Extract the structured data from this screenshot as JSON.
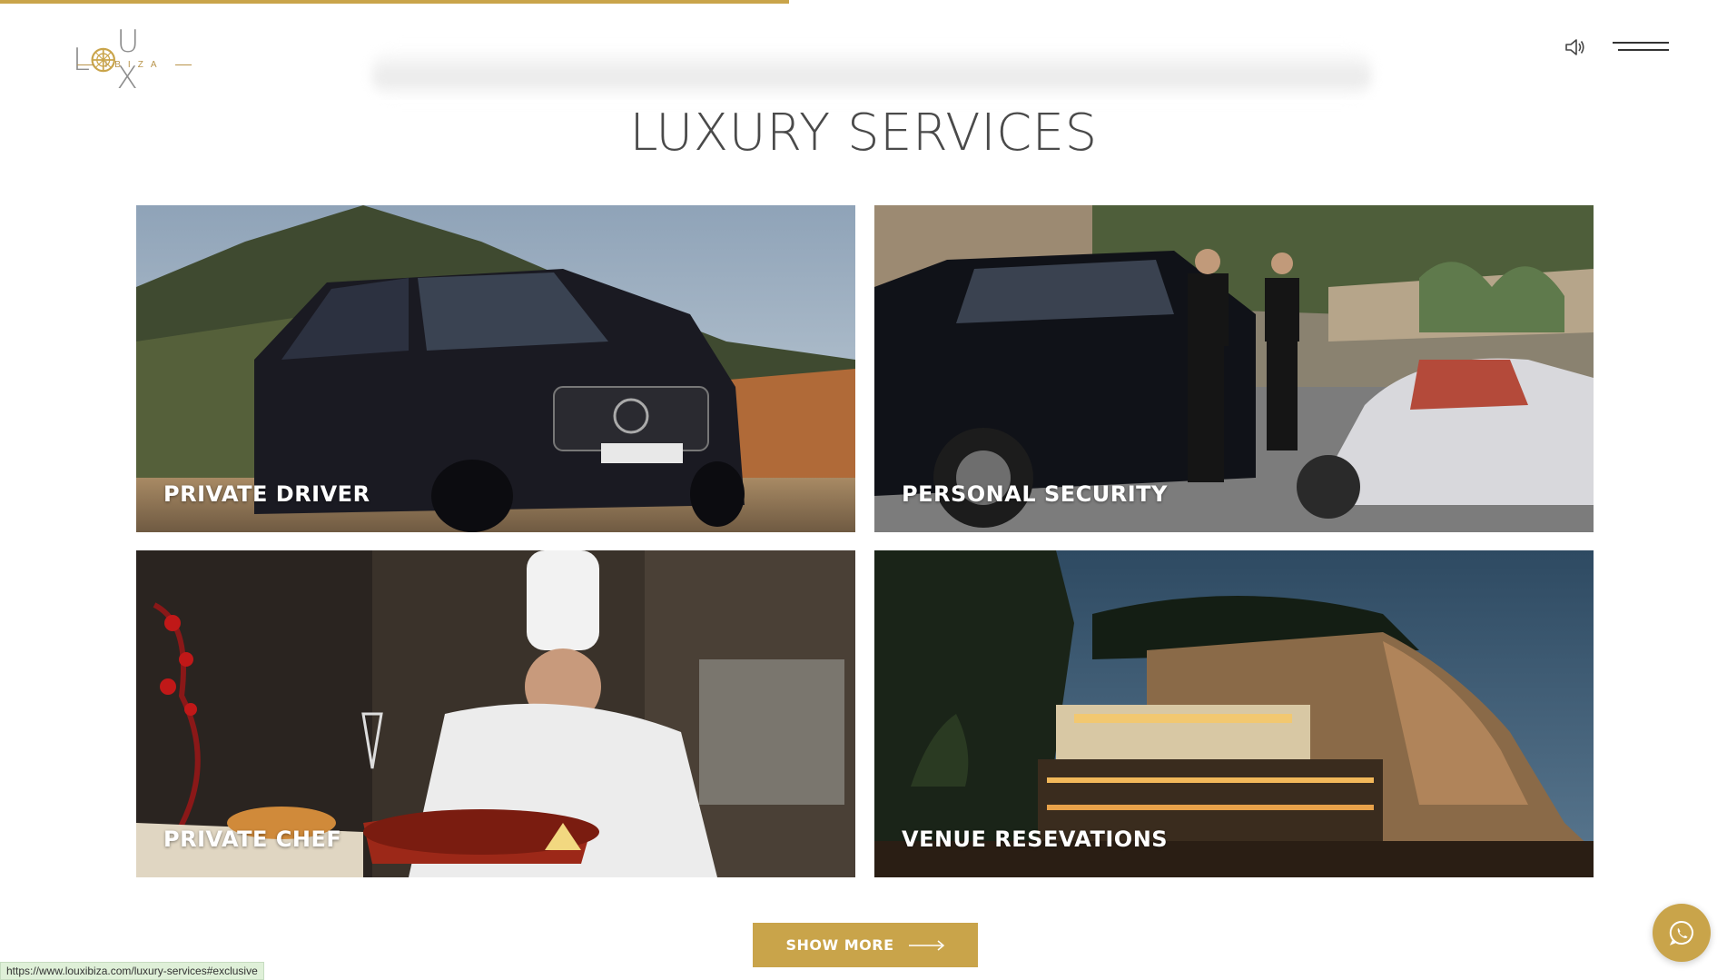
{
  "scroll_progress": 0.457,
  "colors": {
    "accent": "#c9a44a",
    "title": "#4a4a4a",
    "card_label": "#ffffff"
  },
  "logo": {
    "letters_left": "L",
    "letters_right": "U X",
    "subtitle": "IBIZA",
    "emblem_icon": "compass-emblem-icon"
  },
  "header": {
    "sound_icon": "speaker-icon",
    "menu_icon": "hamburger-menu-icon"
  },
  "main": {
    "title": "LUXURY SERVICES",
    "cards": [
      {
        "label": "PRIVATE DRIVER",
        "image": "black-van-mountain-photo"
      },
      {
        "label": "PERSONAL SECURITY",
        "image": "security-guards-cars-photo"
      },
      {
        "label": "PRIVATE CHEF",
        "image": "chef-plating-photo"
      },
      {
        "label": "VENUE RESEVATIONS",
        "image": "cliffside-restaurant-night-photo"
      }
    ],
    "show_more_label": "SHOW MORE",
    "show_more_icon": "long-arrow-right-icon"
  },
  "status_bar": {
    "url": "https://www.louxibiza.com/luxury-services#exclusive"
  },
  "chat": {
    "icon": "whatsapp-icon"
  }
}
